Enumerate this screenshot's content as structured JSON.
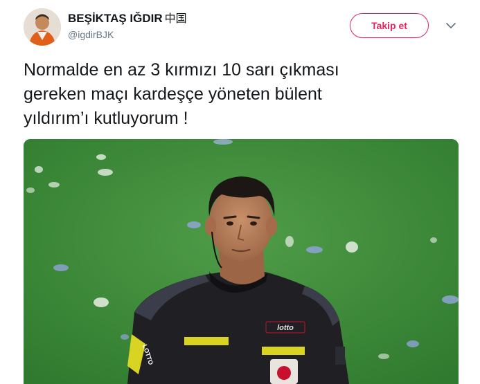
{
  "tweet": {
    "display_name": "BEŞİKTAŞ IĞDIR",
    "display_name_suffix": "中国",
    "username": "@igdirBJK",
    "follow_label": "Takip et",
    "text_lines": [
      "Normalde en az 3 kırmızı 10 sarı çıkması",
      "gereken maçı kardeşçe yöneten bülent",
      "yıldırım’ı kutluyorum !"
    ]
  },
  "media": {
    "jersey_brand": "lotto",
    "sleeve_brand": "LOTTO"
  },
  "icons": {
    "menu": "chevron-down-icon",
    "avatar": "avatar-icon"
  },
  "colors": {
    "accent": "#e0245e",
    "secondary_text": "#657786",
    "pitch": "#3d8c3a"
  }
}
